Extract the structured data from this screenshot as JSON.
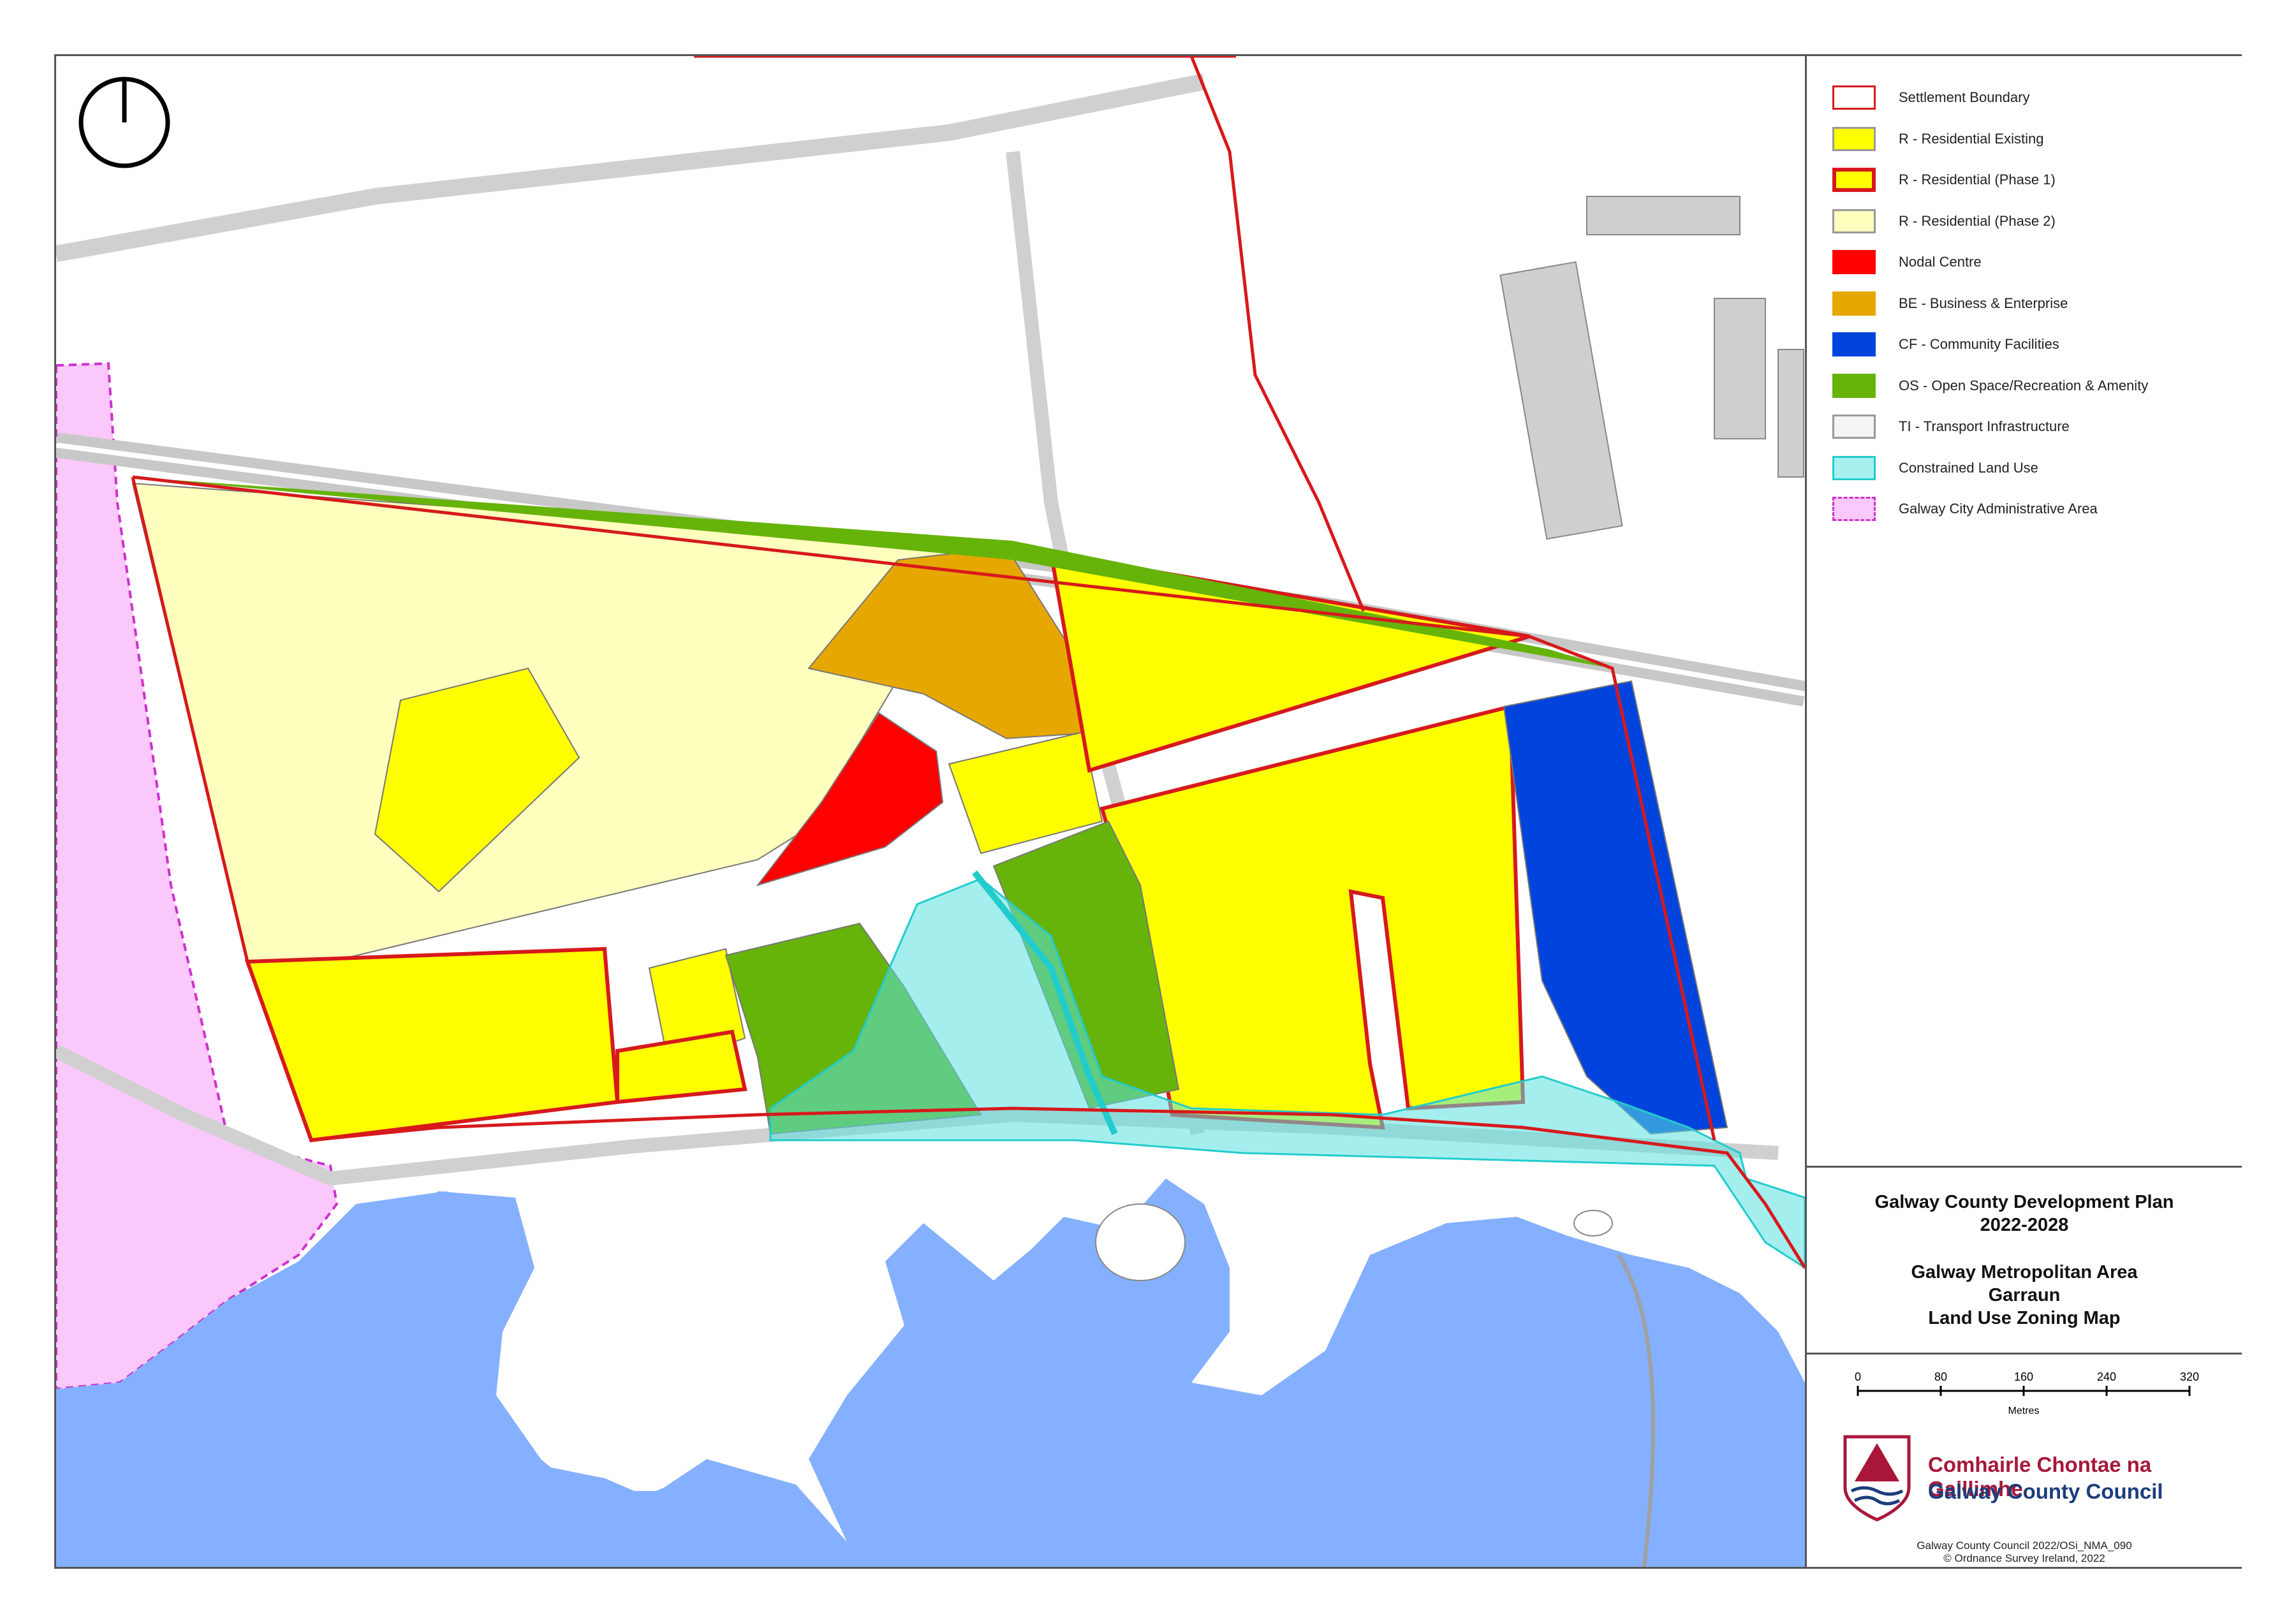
{
  "legend": {
    "items": [
      {
        "label": "Settlement Boundary",
        "fill": "#ffffff",
        "stroke": "#d7191c"
      },
      {
        "label": "R - Residential Existing",
        "fill": "#ffff00",
        "stroke": "#999999"
      },
      {
        "label": "R - Residential (Phase 1)",
        "fill": "#ffff00",
        "stroke": "#d7191c"
      },
      {
        "label": "R - Residential (Phase 2)",
        "fill": "#ffffbe",
        "stroke": "#999999"
      },
      {
        "label": "Nodal Centre",
        "fill": "#ff0000",
        "stroke": "#ff0000"
      },
      {
        "label": "BE - Business & Enterprise",
        "fill": "#e6a800",
        "stroke": "#e6a800"
      },
      {
        "label": "CF - Community Facilities",
        "fill": "#0044dd",
        "stroke": "#0044dd"
      },
      {
        "label": "OS - Open Space/Recreation & Amenity",
        "fill": "#66b30a",
        "stroke": "#66b30a"
      },
      {
        "label": "TI - Transport Infrastructure",
        "fill": "#f4f4f4",
        "stroke": "#999999"
      },
      {
        "label": "Constrained Land Use",
        "fill": "#a8f0f0",
        "stroke": "#22cccc"
      },
      {
        "label": "Galway City Administrative Area",
        "fill": "#fbc8fb",
        "stroke": "#cc33cc"
      }
    ]
  },
  "title": {
    "line1": "Galway County Development Plan",
    "line2": "2022-2028",
    "line3": "Galway Metropolitan Area",
    "line4": "Garraun",
    "line5": "Land Use Zoning Map"
  },
  "scale": {
    "ticks": [
      "0",
      "80",
      "160",
      "240",
      "320"
    ],
    "unit": "Metres"
  },
  "council": {
    "name_ga": "Comhairle Chontae na Gaillimhe",
    "name_en": "Galway County Council"
  },
  "credits": {
    "line1": "Galway County Council 2022/OSi_NMA_090",
    "line2": "© Ordnance Survey Ireland, 2022"
  },
  "colors": {
    "sea": "#84b0ff",
    "residential_existing": "#ffff00",
    "residential_phase2": "#ffffbe",
    "nodal": "#ff0000",
    "business": "#e6a800",
    "community": "#0044dd",
    "open_space": "#66b30a",
    "boundary": "#d7191c",
    "city_area": "#fbc8fb"
  }
}
